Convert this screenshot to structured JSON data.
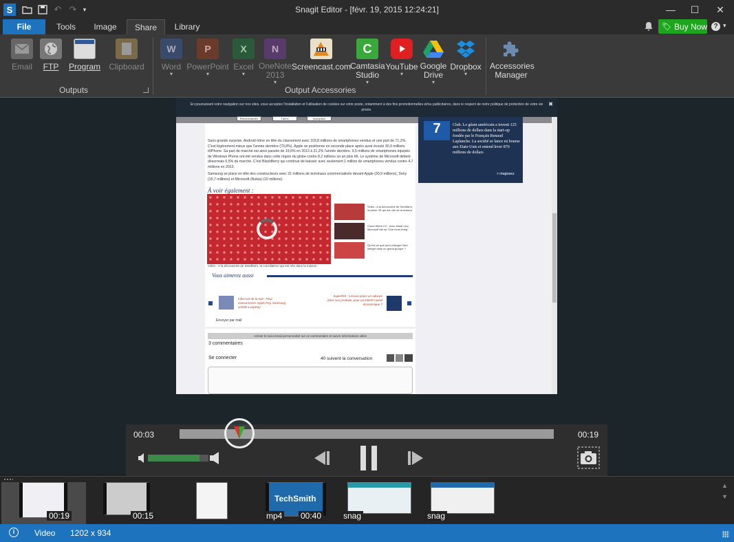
{
  "app": {
    "title": "Snagit Editor - [févr. 19, 2015 12:24:21]",
    "logo": "S",
    "buy_now": "Buy Now",
    "help": "?"
  },
  "tabs": [
    "File",
    "Tools",
    "Image",
    "Share",
    "Library"
  ],
  "ribbon": {
    "outputs_label": "Outputs",
    "accessories_label": "Output Accessories",
    "items": [
      {
        "label": "Email",
        "icon": "email-icon",
        "enabled": false
      },
      {
        "label": "FTP",
        "icon": "globe-icon",
        "enabled": true
      },
      {
        "label": "Program",
        "icon": "program-icon",
        "enabled": true
      },
      {
        "label": "Clipboard",
        "icon": "clipboard-icon",
        "enabled": false
      },
      {
        "label": "Word",
        "icon": "word-icon",
        "enabled": false
      },
      {
        "label": "PowerPoint",
        "icon": "powerpoint-icon",
        "enabled": false
      },
      {
        "label": "Excel",
        "icon": "excel-icon",
        "enabled": false
      },
      {
        "label": "OneNote 2013",
        "icon": "onenote-icon",
        "enabled": false
      },
      {
        "label": "Screencast.com",
        "icon": "screencast-icon",
        "enabled": true
      },
      {
        "label": "Camtasia Studio",
        "icon": "camtasia-icon",
        "enabled": true
      },
      {
        "label": "YouTube",
        "icon": "youtube-icon",
        "enabled": true
      },
      {
        "label": "Google Drive",
        "icon": "google-drive-icon",
        "enabled": true
      },
      {
        "label": "Dropbox",
        "icon": "dropbox-icon",
        "enabled": true
      },
      {
        "label": "Accessories Manager",
        "icon": "puzzle-icon",
        "enabled": true
      }
    ]
  },
  "capture": {
    "cookie_notice": "En poursuivant votre navigation sur nos sites, vous acceptez l'installation et l'utilisation de cookies sur votre poste, notamment à des fins promotionnelles et/ou publicitaires, dans le respect de notre politique de protection de votre vie privée.",
    "share_buttons": [
      "Recommander",
      "J'aime",
      "Inscription"
    ],
    "article_text": "Sans grande surprise, Android trône en tête du classement avec 103,8 millions de smartphones vendus et une part de 71,2%. C'est légèrement mieux que l'année dernière (70,8%). Apple se positionne en seconde place après avoir écoulé 30,9 millions d'iPhone. Sa part de marché est ainsi passée de 19,6% en 2013 à 21,2% l'année dernière. 9,5 millions de smartphones équipés de Windows Phone ont été vendus dans cette région du globe contre 8,2 millions un an plus tôt. Le système de Microsoft détient désormais 6,5% du marché. C'est BlackBerry qui continue de baisser avec seulement 1 million de smartphones vendus contre 4,7 millions en 2013.",
    "article_text2": "Samsung se place en tête des constructeurs avec 31 millions de terminaux commercialisés devant Apple (30,9 millions), Sony (15,7 millions) et Microsoft (Nokia) (10 millions).",
    "see_also": "À voir également :",
    "you_like": "Vous aimerez aussi",
    "side_news": "Club. Le géant américain a investi 125 millions de dollars dans la start-up fondée par le Français Renaud Laplanche. La société se lance en bourse aux Etats-Unis et entend lever 870 millions de dollars",
    "react": "> réagissez",
    "rank": "7",
    "caption": "Vidéo : A la découverte de Seedfarm, la conciliatrice qui est née dans la maison",
    "vid1": "Vidéo : A la découverte de Seedfarm, la dame 3D qui est née de la maison",
    "vid2": "Cloud Week 2.0 - Avec Mobil Linc: Microsoft fait sa \"One more thing\"",
    "vid3": "Qu'est-ce que peut changer l'être intégré dans un grand groupe ?",
    "rec1": "Infos US de la nuit : Pour concurrencer Apple Pay, Samsung achète LoopPay",
    "rec2": "Superfish : Lenovo place un adware dans ses produits, pour un intérêt ravisé économique ?",
    "mail": "Envoyer par mail",
    "comment_notice": "Activer le suivi email personnalisé sur ce commentaire et suivre informations utiles",
    "comments_count": "3 commentaires",
    "login": "Se connecter",
    "followers": "40 suivent la conversation"
  },
  "player": {
    "current_time": "00:03",
    "total_time": "00:19",
    "progress": 0.16,
    "volume": 0.85
  },
  "tray": [
    {
      "label": "00:19",
      "type": "video"
    },
    {
      "label": "00:15",
      "type": "video"
    },
    {
      "label": "",
      "type": "image"
    },
    {
      "label": "mp4",
      "label2": "00:40",
      "type": "techsmith"
    },
    {
      "label": "snag",
      "type": "image"
    },
    {
      "label": "snag",
      "type": "image"
    }
  ],
  "tray_logo": "TechSmith",
  "status": {
    "type": "Video",
    "dimensions": "1202 x 934"
  }
}
